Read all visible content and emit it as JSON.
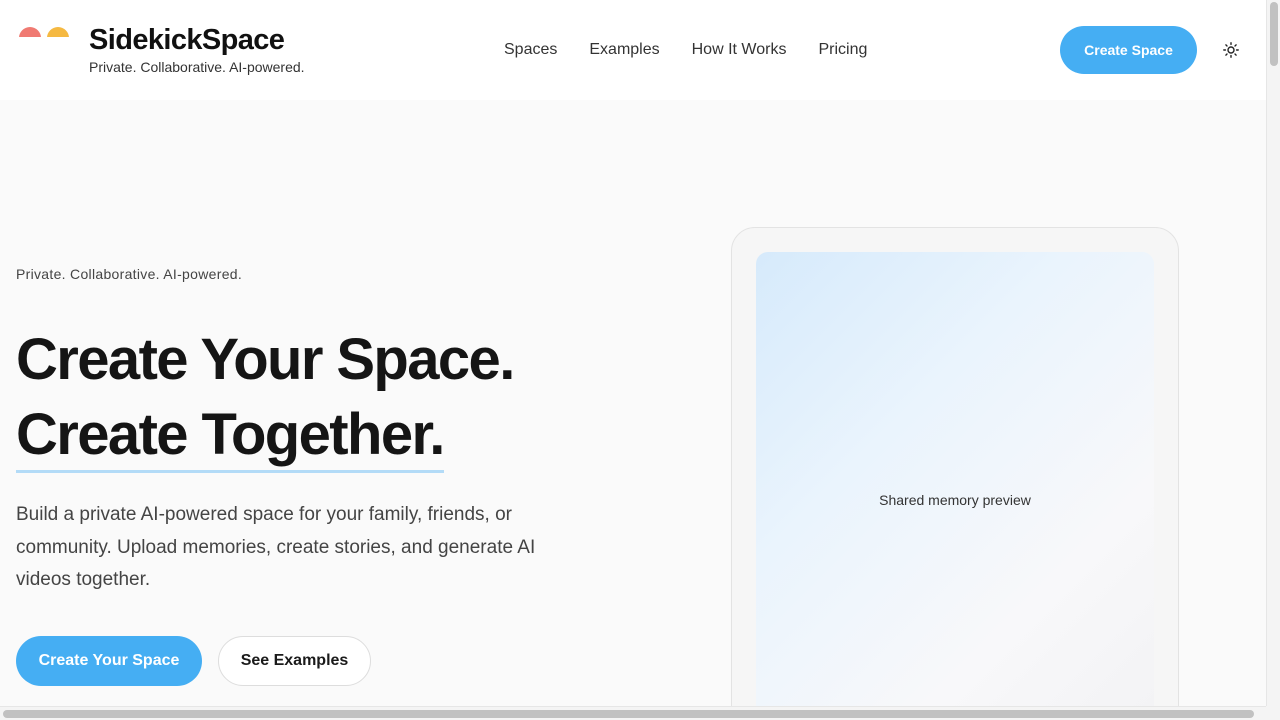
{
  "brand": {
    "name": "SidekickSpace",
    "tagline": "Private. Collaborative. AI-powered.",
    "colors": {
      "red": "#f07a72",
      "yellow": "#f5b942"
    }
  },
  "nav": {
    "items": [
      {
        "label": "Spaces"
      },
      {
        "label": "Examples"
      },
      {
        "label": "How It Works"
      },
      {
        "label": "Pricing"
      }
    ]
  },
  "header": {
    "cta_label": "Create Space",
    "theme_icon": "sun-icon"
  },
  "hero": {
    "eyebrow": "Private. Collaborative. AI-powered.",
    "headline_line1": "Create Your Space.",
    "headline_line2": "Create Together.",
    "description": "Build a private AI-powered space for your family, friends, or community. Upload memories, create stories, and generate AI videos together.",
    "primary_cta": "Create Your Space",
    "secondary_cta": "See Examples"
  },
  "preview": {
    "label": "Shared memory preview"
  },
  "theme": {
    "accent": "#45aef3",
    "underline": "#b3dbf7"
  }
}
